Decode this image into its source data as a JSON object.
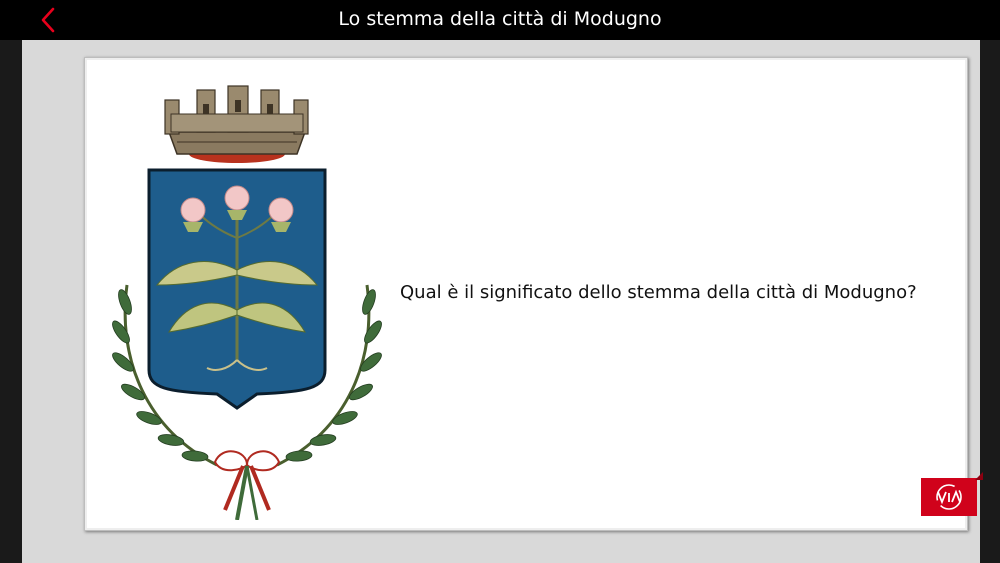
{
  "header": {
    "title": "Lo stemma della città di Modugno",
    "back_icon": "chevron-left-icon"
  },
  "content": {
    "image_subject": "coat-of-arms",
    "question": "Qual è il significato dello stemma della città di Modugno?"
  },
  "help_button": {
    "icon": "via-logo-icon"
  },
  "colors": {
    "accent": "#d0021b",
    "shield": "#1e5d8c",
    "header": "#000000",
    "stage": "#d9d9d9"
  }
}
